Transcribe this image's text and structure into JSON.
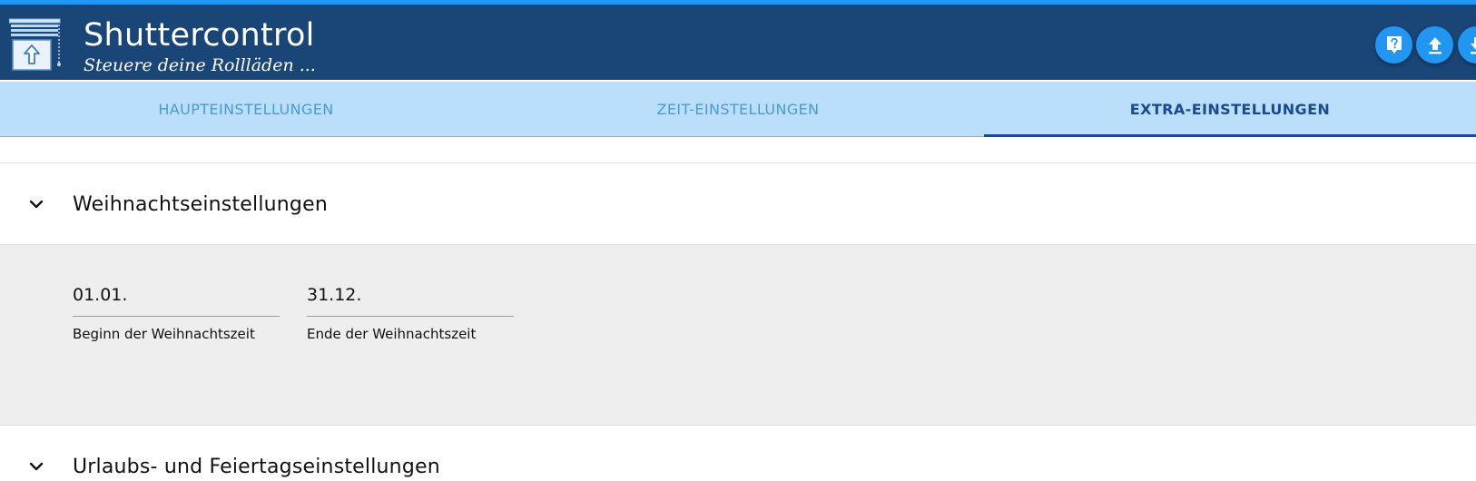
{
  "app": {
    "title": "Shuttercontrol",
    "subtitle": "Steuere deine Rollläden ...",
    "logo_icon": "window-shutter-up-icon"
  },
  "header_buttons": [
    {
      "name": "help-button",
      "icon": "help-icon"
    },
    {
      "name": "upload-button",
      "icon": "upload-icon"
    },
    {
      "name": "download-button",
      "icon": "download-icon"
    }
  ],
  "tabs": [
    {
      "label": "HAUPTEINSTELLUNGEN",
      "active": false
    },
    {
      "label": "ZEIT-EINSTELLUNGEN",
      "active": false
    },
    {
      "label": "EXTRA-EINSTELLUNGEN",
      "active": true
    }
  ],
  "sections": [
    {
      "title": "Weihnachtseinstellungen",
      "expanded": true,
      "fields": [
        {
          "value": "01.01.",
          "label": "Beginn der Weihnachtszeit"
        },
        {
          "value": "31.12.",
          "label": "Ende der Weihnachtszeit"
        }
      ]
    },
    {
      "title": "Urlaubs- und Feiertagseinstellungen",
      "expanded": false
    }
  ],
  "colors": {
    "header_bg": "#1a4577",
    "accent": "#2196f3",
    "tab_bar_bg": "#bbdefb",
    "tab_active": "#1a4a8f",
    "tab_inactive": "#4a9ad8",
    "panel_bg": "#eeeeee"
  }
}
